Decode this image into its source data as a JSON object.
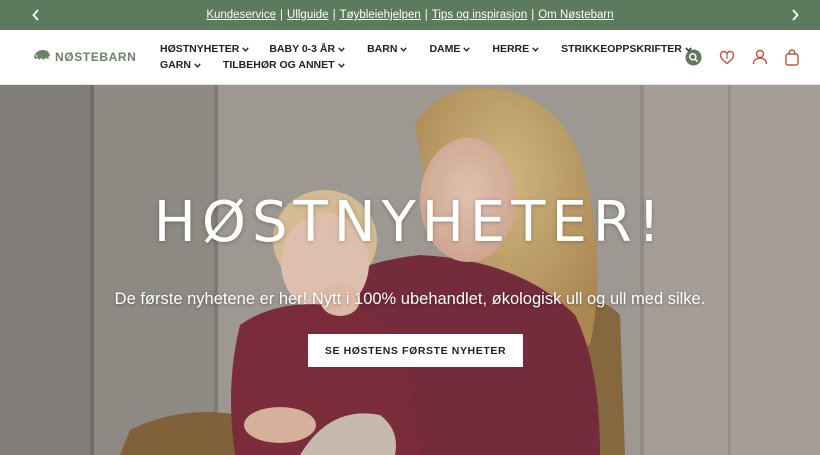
{
  "colors": {
    "topbar_bg": "#5c7a5c",
    "brand_green": "#6b8466",
    "search_bg": "#5c7a5c",
    "icon_accent": "#c0533d"
  },
  "topbar": {
    "prev_icon": "chevron-left-icon",
    "next_icon": "chevron-right-icon",
    "links": [
      "Kundeservice",
      "Ullguide",
      "Tøybleiehjelpen",
      "Tips og inspirasjon",
      "Om Nøstebarn"
    ],
    "separator": "|"
  },
  "header": {
    "logo_text": "NØSTEBARN",
    "logo_icon": "hedgehog-icon",
    "nav_row1": [
      "HØSTNYHETER",
      "BABY 0-3 ÅR",
      "BARN",
      "DAME",
      "HERRE",
      "STRIKKEOPPSKRIFTER"
    ],
    "nav_row2": [
      "GARN",
      "TILBEHØR OG ANNET"
    ],
    "icons": [
      "search-icon",
      "wishlist-icon",
      "account-icon",
      "cart-icon"
    ]
  },
  "hero": {
    "title": "HØSTNYHETER!",
    "subtitle": "De første nyhetene er her! Nytt i 100% ubehandlet, økologisk ull og ull med silke.",
    "button_label": "SE HØSTENS FØRSTE NYHETER"
  }
}
